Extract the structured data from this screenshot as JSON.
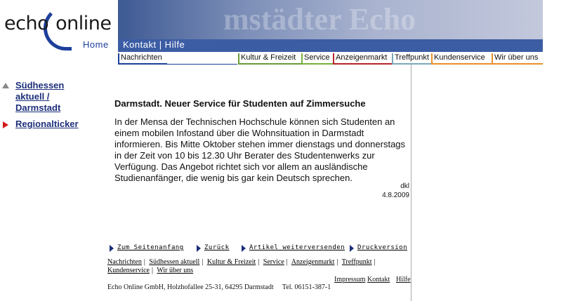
{
  "header": {
    "logo_left": "echo",
    "logo_right": "online",
    "banner_word": "mstädter Echo",
    "home_label": "Home",
    "kontakt_label": "Kontakt | Hilfe"
  },
  "menu": [
    {
      "label": "Nachrichten",
      "color": "#1c3f9a"
    },
    {
      "label": "Kultur & Freizeit",
      "color": "#6a9a3a"
    },
    {
      "label": "Service",
      "color": "#7ab03c"
    },
    {
      "label": "Anzeigenmarkt",
      "color": "#b8252a"
    },
    {
      "label": "Treffpunkt",
      "color": "#7aa8b8"
    },
    {
      "label": "Kundenservice",
      "color": "#e8902a"
    },
    {
      "label": "Wir über uns",
      "color": "#e8902a"
    }
  ],
  "leftnav": {
    "item1": "Südhessen aktuell / Darmstadt",
    "item1_line1": "Südhessen",
    "item1_line2": "aktuell /",
    "item1_line3": "Darmstadt",
    "item2": "Regionalticker"
  },
  "article": {
    "title": "Darmstadt. Neuer Service für Studenten auf Zimmersuche",
    "body": "In der Mensa der Technischen Hochschule können sich Studenten an einem mobilen Infostand über die Wohnsituation in Darmstadt informieren. Bis Mitte Oktober stehen immer dienstags und donnerstags in der Zeit von 10 bis 12.30 Uhr Berater des Studentenwerks zur Verfügung. Das Angebot richtet sich vor allem an ausländische Studienanfänger, die wenig bis gar kein Deutsch sprechen.",
    "author": "dkl",
    "date": "4.8.2009"
  },
  "actions": [
    "Zum Seitenanfang",
    "Zurück",
    "Artikel weiterversenden",
    "Druckversion"
  ],
  "footer_links": [
    "Nachrichten",
    "Südhessen aktuell",
    "Kultur & Freizeit",
    "Service",
    "Anzeigenmarkt",
    "Treffpunkt",
    "Kundenservice",
    "Wir über uns"
  ],
  "footer_right": [
    "Impressum",
    "Kontakt",
    "Hilfe"
  ],
  "address": "Echo Online GmbH, Holzhofallee 25-31, 64295 Darmstadt     Tel. 06151-387-1"
}
